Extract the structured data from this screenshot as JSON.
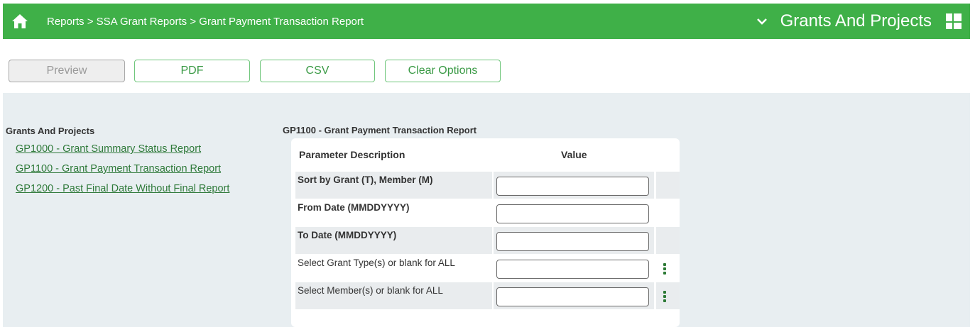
{
  "header": {
    "breadcrumb": "Reports > SSA Grant Reports > Grant Payment Transaction Report",
    "app_title": "Grants And Projects",
    "icons": [
      "home-icon",
      "chevron-down-icon",
      "layout-grid-icon"
    ],
    "color": "#3fb048"
  },
  "toolbar": {
    "preview_label": "Preview",
    "pdf_label": "PDF",
    "csv_label": "CSV",
    "clear_label": "Clear Options"
  },
  "sidebar": {
    "title": "Grants And Projects",
    "links": [
      "GP1000 - Grant Summary Status Report",
      "GP1100 - Grant Payment Transaction Report",
      "GP1200 - Past Final Date Without Final Report"
    ]
  },
  "report": {
    "title": "GP1100 - Grant Payment Transaction Report",
    "columns": [
      "Parameter Description",
      "Value"
    ],
    "params": [
      {
        "label": "Sort by Grant (T), Member (M)",
        "value": ""
      },
      {
        "label": "From Date (MMDDYYYY)",
        "value": ""
      },
      {
        "label": "To Date (MMDDYYYY)",
        "value": ""
      },
      {
        "label": "Select Grant Type(s) or blank for ALL",
        "value": ""
      },
      {
        "label": "Select Member(s) or blank for ALL",
        "value": ""
      }
    ]
  }
}
